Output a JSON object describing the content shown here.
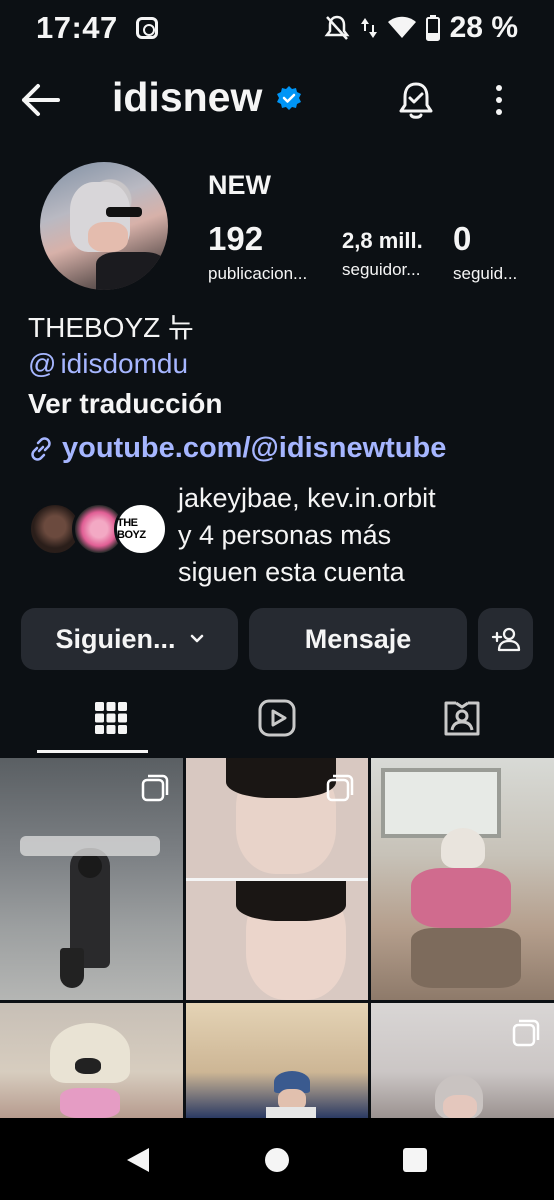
{
  "status_bar": {
    "time": "17:47",
    "battery": "28 %",
    "icons": [
      "instagram-icon",
      "mute-icon",
      "data-icon",
      "wifi-icon",
      "battery-icon"
    ]
  },
  "header": {
    "username": "idisnew",
    "verified": true,
    "back_icon": "arrow-left-icon",
    "bell_icon": "bell-check-icon",
    "more_icon": "more-vertical-icon"
  },
  "profile": {
    "display_name": "NEW",
    "stats": [
      {
        "value": "192",
        "label": "publicacion..."
      },
      {
        "value": "2,8 mill.",
        "label": "seguidor..."
      },
      {
        "value": "0",
        "label": "seguid..."
      }
    ]
  },
  "bio": {
    "name_line": "THEBOYZ 뉴",
    "threads_handle": "idisdomdu",
    "translate_label": "Ver traducción",
    "link": "youtube.com/@idisnewtube"
  },
  "followed_by": {
    "text_line1": "jakeyjbae, kev.in.orbit",
    "text_line2": "y 4 personas más",
    "text_line3": "siguen esta cuenta",
    "badge_text": "THE BOYZ"
  },
  "actions": {
    "following_label": "Siguien...",
    "message_label": "Mensaje"
  },
  "tabs": [
    {
      "name": "grid",
      "icon": "grid-icon",
      "active": true
    },
    {
      "name": "reels",
      "icon": "reels-icon",
      "active": false
    },
    {
      "name": "tagged",
      "icon": "tagged-icon",
      "active": false
    }
  ],
  "colors": {
    "background": "#0c1014",
    "button": "#262a31",
    "link": "#a6b6ff",
    "verified": "#0095f6"
  }
}
